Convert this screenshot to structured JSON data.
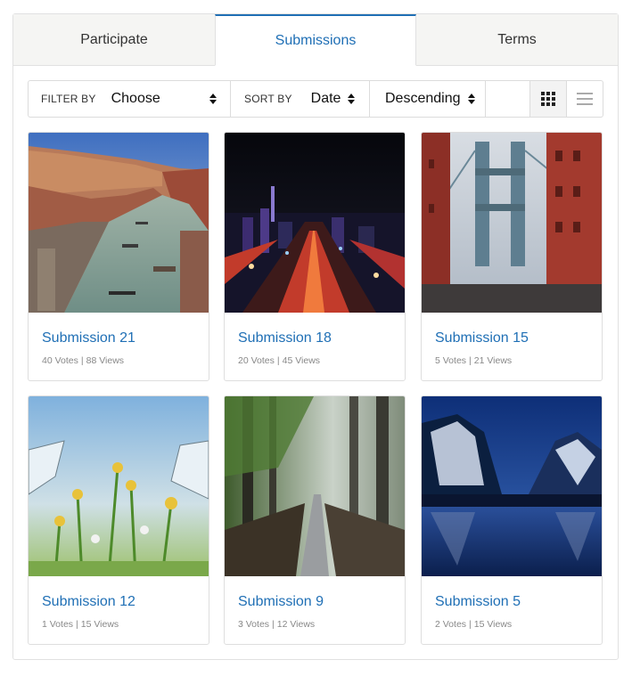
{
  "tabs": [
    {
      "label": "Participate",
      "active": false
    },
    {
      "label": "Submissions",
      "active": true
    },
    {
      "label": "Terms",
      "active": false
    }
  ],
  "toolbar": {
    "filter_label": "FILTER BY",
    "filter_value": "Choose",
    "sort_label": "SORT BY",
    "sort_value": "Date",
    "order_value": "Descending",
    "view_mode": "grid"
  },
  "submissions": [
    {
      "title": "Submission 21",
      "votes": "40 Votes",
      "views": "88 Views",
      "image": "venice-canal"
    },
    {
      "title": "Submission 18",
      "votes": "20 Votes",
      "views": "45 Views",
      "image": "night-city"
    },
    {
      "title": "Submission 15",
      "votes": "5 Votes",
      "views": "21 Views",
      "image": "bridge"
    },
    {
      "title": "Submission 12",
      "votes": "1 Votes",
      "views": "15 Views",
      "image": "butterflies-flowers"
    },
    {
      "title": "Submission 9",
      "votes": "3 Votes",
      "views": "12 Views",
      "image": "forest-path"
    },
    {
      "title": "Submission 5",
      "votes": "2 Votes",
      "views": "15 Views",
      "image": "mountain-lake"
    }
  ],
  "colors": {
    "accent": "#1f6fb5",
    "meta_text": "#888888",
    "border": "#dedede",
    "tab_bg": "#f5f5f3"
  }
}
